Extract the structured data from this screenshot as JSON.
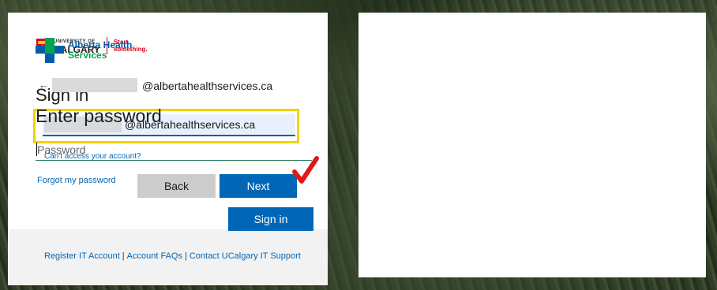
{
  "left_panel": {
    "logo": {
      "line1": "UNIVERSITY OF",
      "line2": "CALGARY",
      "tagline1": "Start",
      "tagline2": "something."
    },
    "title": "Sign in",
    "email_suffix": "@albertahealthservices.ca",
    "cant_access_link": "Can't access your account?",
    "back_label": "Back",
    "next_label": "Next",
    "footer": {
      "register": "Register IT Account",
      "faqs": "Account FAQs",
      "support": "Contact UCalgary IT Support",
      "separator": "|"
    }
  },
  "right_panel": {
    "logo": {
      "line1": "Alberta Health",
      "line2": "Services"
    },
    "back_arrow": "←",
    "email_suffix": "@albertahealthservices.ca",
    "title": "Enter password",
    "password_placeholder": "Password",
    "forgot_link": "Forgot my password",
    "signin_label": "Sign in"
  },
  "colors": {
    "primary_blue": "#0067b8",
    "highlight_yellow": "#f1d300",
    "annotation_red": "#e01818",
    "uc_red": "#d6001c",
    "ahs_blue": "#005daa",
    "ahs_green": "#00a650"
  },
  "icons": [
    "uc-shield-icon",
    "ahs-cross-icon",
    "back-arrow-icon",
    "red-checkmark-icon"
  ]
}
